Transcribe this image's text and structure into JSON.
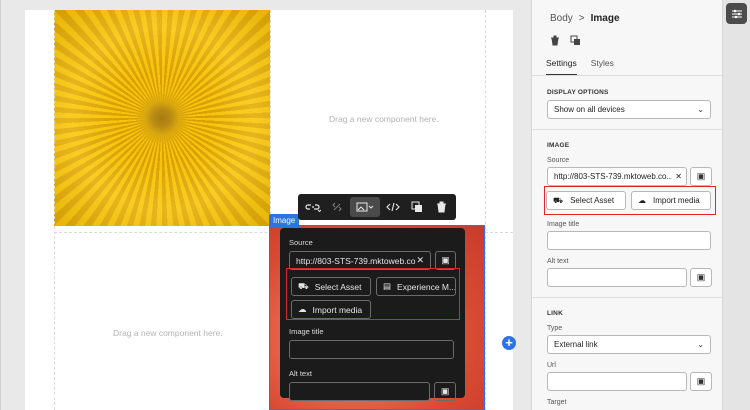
{
  "canvas": {
    "drag_hint_top": "Drag a new component here.",
    "drag_hint_bottom": "Drag a new component here.",
    "image_tag": "Image"
  },
  "toolbar": {
    "link_icon": "link-icon",
    "unlink_icon": "unlink-icon",
    "image_icon": "image-icon",
    "code_icon": "code-icon",
    "duplicate_icon": "duplicate-icon",
    "delete_icon": "trash-icon"
  },
  "popover": {
    "source_label": "Source",
    "source_value": "http://803-STS-739.mktoweb.co...",
    "select_asset": "Select Asset",
    "experience_manager": "Experience M...",
    "import_media": "Import media",
    "image_title_label": "Image title",
    "alt_text_label": "Alt text"
  },
  "panel": {
    "breadcrumb_parent": "Body",
    "breadcrumb_sep": ">",
    "breadcrumb_current": "Image",
    "tabs": [
      "Settings",
      "Styles"
    ],
    "display_options_title": "DISPLAY OPTIONS",
    "display_options_value": "Show on all devices",
    "image_title": "IMAGE",
    "source_label": "Source",
    "source_value": "http://803-STS-739.mktoweb.co...",
    "select_asset": "Select Asset",
    "import_media": "Import media",
    "image_title_label": "Image title",
    "alt_text_label": "Alt text",
    "link_title": "LINK",
    "type_label": "Type",
    "type_value": "External link",
    "url_label": "Url",
    "target_label": "Target"
  },
  "colors": {
    "accent_blue": "#2c74e6",
    "highlight_red": "#e0262d"
  }
}
